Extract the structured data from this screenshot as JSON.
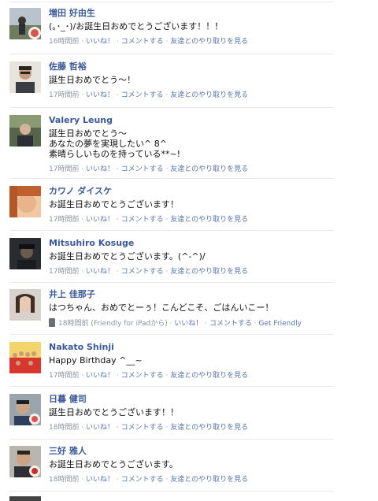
{
  "posts": [
    {
      "name": "増田 好由生",
      "message": [
        "(｡･_･)/お誕生日おめでとうございます！！！"
      ],
      "time": "16時間前",
      "via": "",
      "actions": [
        "いいね！",
        "コメントする",
        "友達とのやり取りを見る"
      ]
    },
    {
      "name": "佐藤 哲裕",
      "message": [
        "誕生日おめでとう～！"
      ],
      "time": "17時間前",
      "via": "",
      "actions": [
        "いいね！",
        "コメントする",
        "友達とのやり取りを見る"
      ]
    },
    {
      "name": "Valery Leung",
      "message": [
        "誕生日おめでとう～",
        "あなたの夢を実現したい^ 8^",
        "素晴らしいものを持っている**~!"
      ],
      "time": "17時間前",
      "via": "",
      "actions": [
        "いいね！",
        "コメントする",
        "友達とのやり取りを見る"
      ]
    },
    {
      "name": "カワノ ダイスケ",
      "message": [
        "お誕生日おめでとうございます！"
      ],
      "time": "17時間前",
      "via": "",
      "actions": [
        "いいね！",
        "コメントする",
        "友達とのやり取りを見る"
      ]
    },
    {
      "name": "Mitsuhiro Kosuge",
      "message": [
        "お誕生日おめでとうございます。(^-^)/"
      ],
      "time": "17時間前",
      "via": "",
      "actions": [
        "いいね！",
        "コメントする",
        "友達とのやり取りを見る"
      ]
    },
    {
      "name": "井上 佳那子",
      "message": [
        "はつちゃん、おめでとーぅ！こんどこそ、ごはんいこー！"
      ],
      "time": "18時間前",
      "via": "(Friendly for iPadから)",
      "actions": [
        "いいね！",
        "コメントする",
        "Get Friendly"
      ]
    },
    {
      "name": "Nakato Shinji",
      "message": [
        "Happy Birthday ^__~"
      ],
      "time": "17時間前",
      "via": "",
      "actions": [
        "いいね！",
        "コメントする",
        "友達とのやり取りを見る"
      ]
    },
    {
      "name": "日暮 健司",
      "message": [
        "誕生日おめでとうございます！！"
      ],
      "time": "18時間前",
      "via": "",
      "actions": [
        "いいね！",
        "コメントする",
        "友達とのやり取りを見る"
      ]
    },
    {
      "name": "三好 雅人",
      "message": [
        "お誕生日おめでとうございます。"
      ],
      "time": "18時間前",
      "via": "",
      "actions": [
        "いいね！",
        "コメントする",
        "友達とのやり取りを見る"
      ]
    }
  ],
  "colors": {
    "name_link": "#3b5998",
    "action_link": "#5b74a8",
    "meta_gray": "#8d949e",
    "separator": "#e9eaed"
  }
}
